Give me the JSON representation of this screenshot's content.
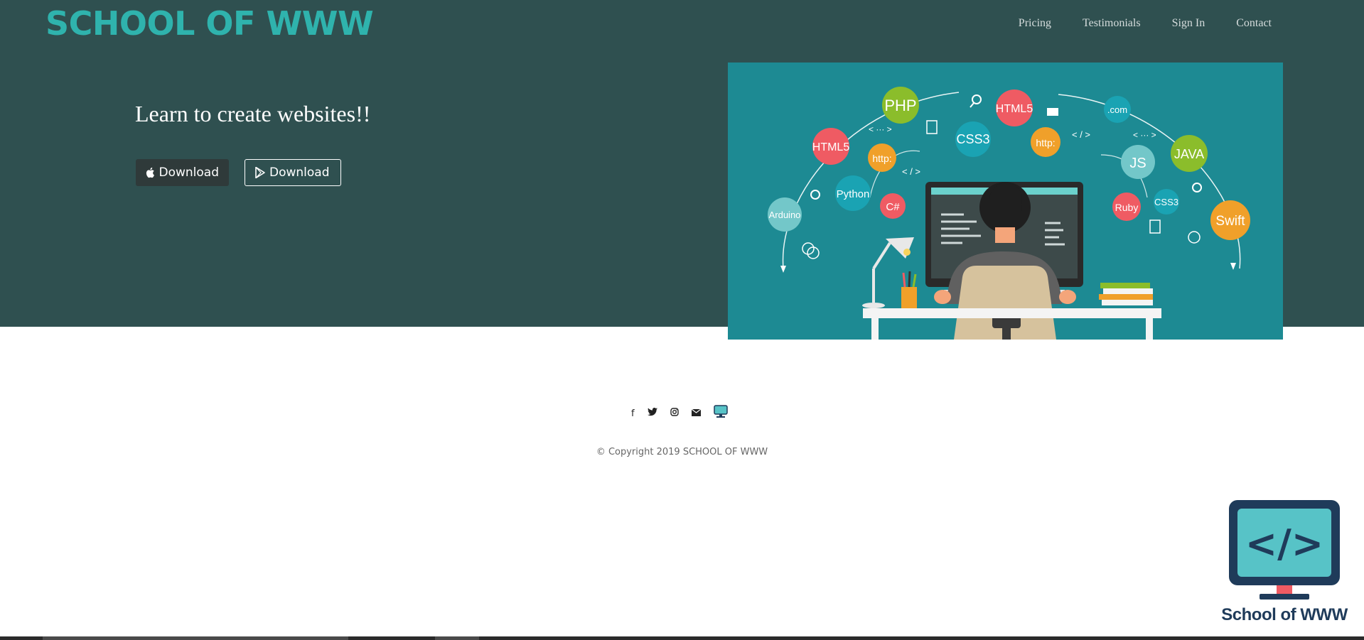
{
  "brand": {
    "title": "SCHOOL OF WWW"
  },
  "nav": {
    "items": [
      "Pricing",
      "Testimonials",
      "Sign In",
      "Contact"
    ]
  },
  "hero": {
    "headline": "Learn to create websites!!",
    "apple_button_label": "Download",
    "play_button_label": "Download",
    "illustration": {
      "bubbles": [
        "PHP",
        "HTML5",
        "HTML5",
        "CSS3",
        "http:",
        "http:",
        "Python",
        "C#",
        "Arduino",
        ".com",
        "JS",
        "JAVA",
        "Ruby",
        "CSS3",
        "Swift"
      ],
      "tags": [
        "< ··· >",
        "< / >",
        "< / >",
        "< ··· >"
      ],
      "colors": {
        "background": "#1d8a93",
        "accent_red": "#ef5b63",
        "accent_green": "#8bbd2b",
        "accent_orange": "#f0a02a",
        "accent_teal": "#1aa3b3"
      }
    }
  },
  "socials": {
    "icons": [
      "facebook-icon",
      "twitter-icon",
      "instagram-icon",
      "email-icon",
      "school-logo-icon"
    ]
  },
  "footer": {
    "copyright": "© Copyright 2019 SCHOOL OF WWW"
  },
  "logo": {
    "text": "School of WWW",
    "code_glyph": "</>"
  },
  "colors": {
    "hero_bg": "#2f5050",
    "brand": "#2fb3ad",
    "logo_blue": "#1f3b5a",
    "logo_screen": "#57c3c7"
  }
}
